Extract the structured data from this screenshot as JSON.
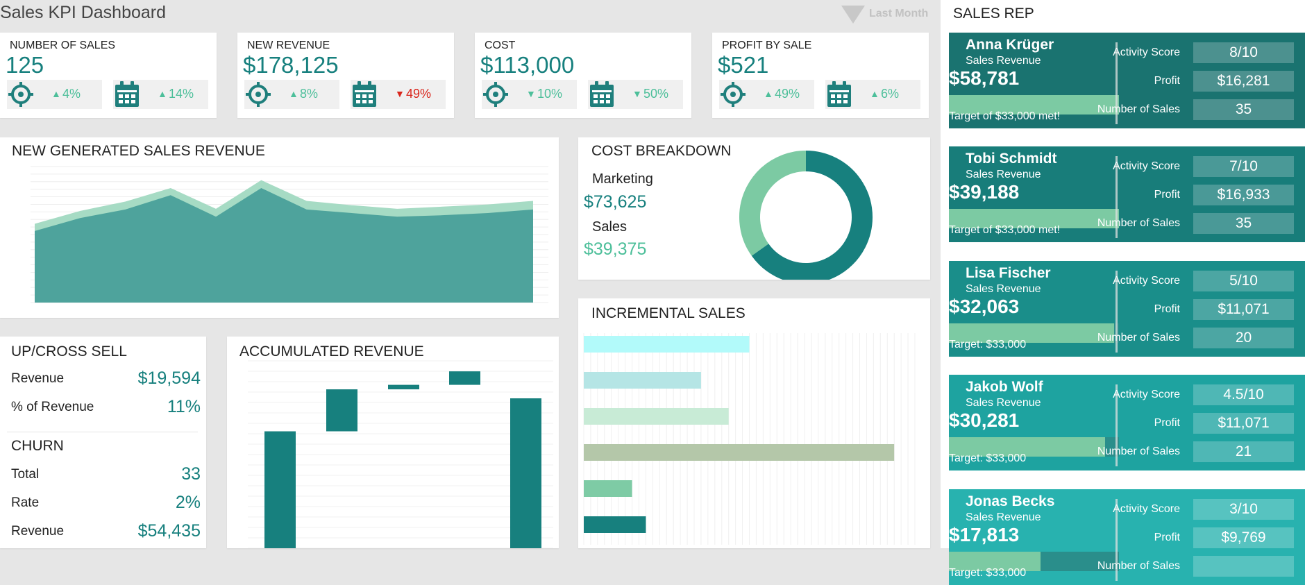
{
  "header": {
    "title": "Sales KPI Dashboard",
    "period_label": "Last Month"
  },
  "kpis": [
    {
      "label": "NUMBER OF SALES",
      "value": "125",
      "target_change": "4%",
      "target_dir": "up",
      "period_change": "14%",
      "period_dir": "up"
    },
    {
      "label": "NEW REVENUE",
      "value": "$178,125",
      "target_change": "8%",
      "target_dir": "up",
      "period_change": "49%",
      "period_dir": "down-red"
    },
    {
      "label": "COST",
      "value": "$113,000",
      "target_change": "10%",
      "target_dir": "down",
      "period_change": "50%",
      "period_dir": "down"
    },
    {
      "label": "PROFIT BY SALE",
      "value": "$521",
      "target_change": "49%",
      "target_dir": "up",
      "period_change": "6%",
      "period_dir": "up"
    }
  ],
  "revenue_chart": {
    "title": "NEW GENERATED SALES REVENUE"
  },
  "cost_breakdown": {
    "title": "COST BREAKDOWN",
    "items": [
      {
        "label": "Marketing",
        "value": "$73,625"
      },
      {
        "label": "Sales",
        "value": "$39,375"
      }
    ]
  },
  "incremental_sales": {
    "title": "INCREMENTAL SALES"
  },
  "accumulated_revenue": {
    "title": "ACCUMULATED REVENUE"
  },
  "upsell": {
    "title": "UP/CROSS SELL",
    "revenue_label": "Revenue",
    "revenue_value": "$19,594",
    "pct_label": "% of Revenue",
    "pct_value": "11%"
  },
  "churn": {
    "title": "CHURN",
    "total_label": "Total",
    "total_value": "33",
    "rate_label": "Rate",
    "rate_value": "2%",
    "revenue_label": "Revenue",
    "revenue_value": "$54,435"
  },
  "sales_rep": {
    "heading": "SALES REP",
    "metric_labels": {
      "activity": "Activity Score",
      "profit": "Profit",
      "num_sales": "Number of Sales"
    },
    "sub_label": "Sales Revenue",
    "reps": [
      {
        "name": "Anna Krüger",
        "revenue": "$58,781",
        "target_text": "Target of $33,000 met!",
        "progress": 1.0,
        "activity": "8/10",
        "profit": "$16,281",
        "num_sales": "35",
        "color": "#1a7370"
      },
      {
        "name": "Tobi Schmidt",
        "revenue": "$39,188",
        "target_text": "Target of $33,000 met!",
        "progress": 1.0,
        "activity": "7/10",
        "profit": "$16,933",
        "num_sales": "35",
        "color": "#187d7a"
      },
      {
        "name": "Lisa Fischer",
        "revenue": "$32,063",
        "target_text": "Target: $33,000",
        "progress": 0.97,
        "activity": "5/10",
        "profit": "$11,071",
        "num_sales": "20",
        "color": "#1a8e8a"
      },
      {
        "name": "Jakob Wolf",
        "revenue": "$30,281",
        "target_text": "Target: $33,000",
        "progress": 0.92,
        "activity": "4.5/10",
        "profit": "$11,071",
        "num_sales": "21",
        "color": "#1ea3a0"
      },
      {
        "name": "Jonas Becks",
        "revenue": "$17,813",
        "target_text": "Target: $33,000",
        "progress": 0.54,
        "activity": "3/10",
        "profit": "$9,769",
        "num_sales": "",
        "color": "#28b2af"
      }
    ]
  },
  "colors": {
    "primary": "#17807e",
    "accent": "#4dbf9a",
    "negative": "#d9261c"
  },
  "chart_data": [
    {
      "type": "area",
      "title": "NEW GENERATED SALES REVENUE",
      "series": [
        {
          "values": [
            100,
            118,
            130,
            150,
            120,
            160,
            130,
            125,
            120,
            122,
            125,
            130
          ]
        },
        {
          "values": [
            110,
            128,
            141,
            160,
            131,
            171,
            142,
            136,
            131,
            134,
            137,
            142
          ]
        }
      ],
      "ylim": [
        0,
        190
      ]
    },
    {
      "type": "pie",
      "title": "COST BREAKDOWN",
      "categories": [
        "Marketing",
        "Sales"
      ],
      "values": [
        73625,
        39375
      ]
    },
    {
      "type": "bar",
      "title": "INCREMENTAL SALES",
      "values": [
        24,
        17,
        21,
        45,
        7,
        9
      ],
      "xlim": [
        0,
        48
      ],
      "colors": [
        "#b2fafa",
        "#b5e5e5",
        "#c8ebd6",
        "#b4c7a9",
        "#7ecba5",
        "#17807e"
      ]
    },
    {
      "type": "bar",
      "title": "ACCUMULATED REVENUE",
      "values": [
        78000,
        28000,
        3000,
        9000,
        100000
      ],
      "bar_kind": [
        "total",
        "increase",
        "increase",
        "increase",
        "total"
      ],
      "ylim": [
        0,
        125000
      ]
    }
  ]
}
